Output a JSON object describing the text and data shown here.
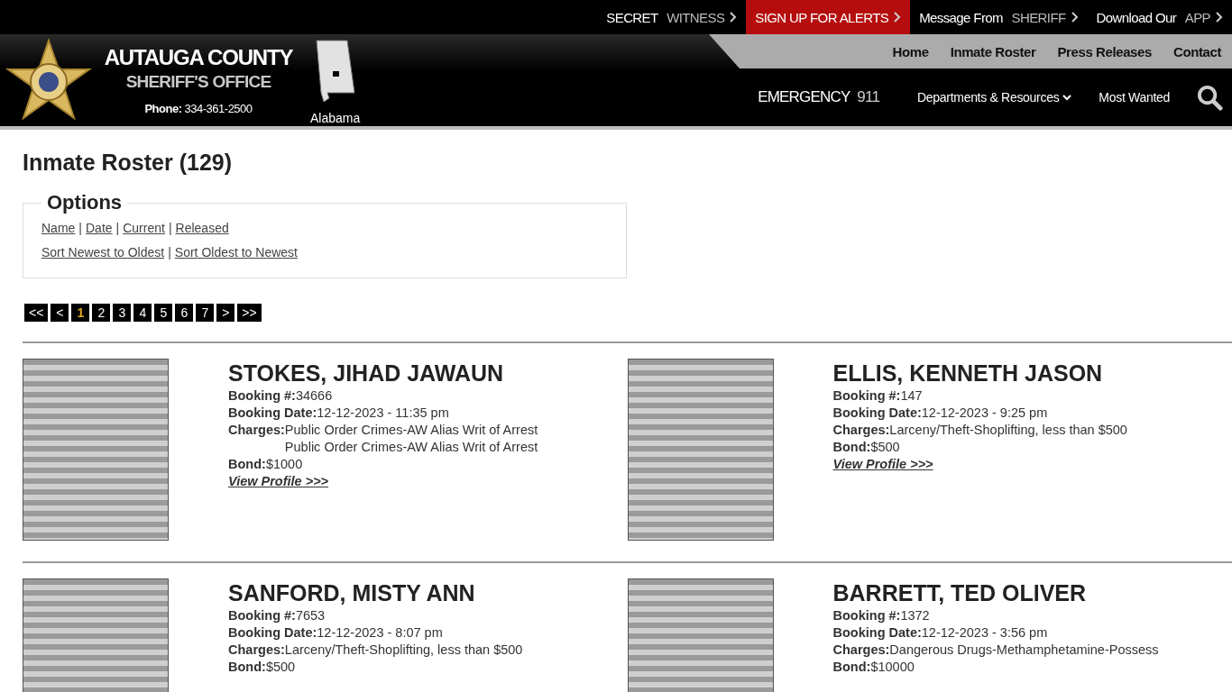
{
  "top_links": [
    {
      "lead": "SECRET",
      "tail": "WITNESS",
      "kind": "plain"
    },
    {
      "lead": "SIGN UP FOR ALERTS",
      "kind": "alert"
    },
    {
      "lead": "Message From",
      "tail": "SHERIFF",
      "kind": "plain"
    },
    {
      "lead": "Download Our",
      "tail": "APP",
      "kind": "plain"
    }
  ],
  "brand": {
    "title": "AUTAUGA COUNTY",
    "subtitle": "SHERIFF'S OFFICE",
    "phone_label": "Phone:",
    "phone": "334-361-2500",
    "state": "Alabama"
  },
  "main_nav": [
    "Home",
    "Inmate Roster",
    "Press Releases",
    "Contact"
  ],
  "sub_nav": {
    "emergency_label": "EMERGENCY",
    "emergency_number": "911",
    "links": [
      {
        "label": "Departments & Resources",
        "dropdown": true
      },
      {
        "label": "Most Wanted",
        "dropdown": false
      }
    ]
  },
  "page_title": "Inmate Roster (129)",
  "options": {
    "legend": "Options",
    "filters": [
      "Name",
      "Date",
      "Current",
      "Released"
    ],
    "sorts": [
      "Sort Newest to Oldest",
      "Sort Oldest to Newest"
    ],
    "separator": "|"
  },
  "pagination": [
    {
      "label": "<<",
      "selected": false
    },
    {
      "label": "<",
      "selected": false
    },
    {
      "label": "1",
      "selected": true
    },
    {
      "label": "2",
      "selected": false
    },
    {
      "label": "3",
      "selected": false
    },
    {
      "label": "4",
      "selected": false
    },
    {
      "label": "5",
      "selected": false
    },
    {
      "label": "6",
      "selected": false
    },
    {
      "label": "7",
      "selected": false
    },
    {
      "label": ">",
      "selected": false
    },
    {
      "label": ">>",
      "selected": false
    }
  ],
  "inmates": [
    {
      "name": "STOKES, JIHAD JAWAUN",
      "booking_label": "Booking #:",
      "booking": "34666",
      "date_label": "Booking Date:",
      "date": "12-12-2023 - 11:35 pm",
      "charges_label": "Charges:",
      "charges": [
        "Public Order Crimes-AW Alias Writ of Arrest",
        "Public Order Crimes-AW Alias Writ of Arrest"
      ],
      "bond_label": "Bond:",
      "bond": "$1000",
      "profile": "View Profile >>>"
    },
    {
      "name": "ELLIS, KENNETH JASON",
      "booking_label": "Booking #:",
      "booking": "147",
      "date_label": "Booking Date:",
      "date": "12-12-2023 - 9:25 pm",
      "charges_label": "Charges:",
      "charges": [
        "Larceny/Theft-Shoplifting, less than $500"
      ],
      "bond_label": "Bond:",
      "bond": "$500",
      "profile": "View Profile >>>"
    },
    {
      "name": "SANFORD, MISTY ANN",
      "booking_label": "Booking #:",
      "booking": "7653",
      "date_label": "Booking Date:",
      "date": "12-12-2023 - 8:07 pm",
      "charges_label": "Charges:",
      "charges": [
        "Larceny/Theft-Shoplifting, less than $500"
      ],
      "bond_label": "Bond:",
      "bond": "$500"
    },
    {
      "name": "BARRETT, TED OLIVER",
      "booking_label": "Booking #:",
      "booking": "1372",
      "date_label": "Booking Date:",
      "date": "12-12-2023 - 3:56 pm",
      "charges_label": "Charges:",
      "charges": [
        "Dangerous Drugs-Methamphetamine-Possess"
      ],
      "bond_label": "Bond:",
      "bond": "$10000"
    }
  ]
}
